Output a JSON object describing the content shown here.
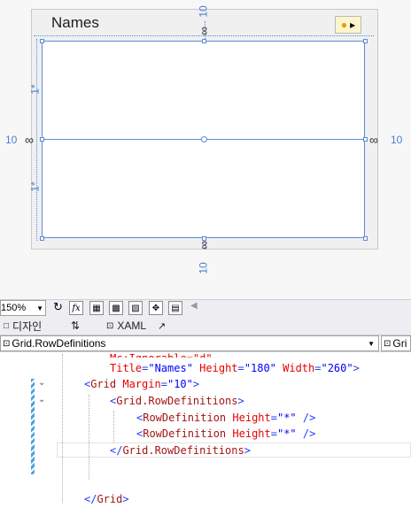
{
  "designer": {
    "window_title": "Names",
    "margin_top": "10",
    "margin_bottom": "10",
    "margin_left": "10",
    "margin_right": "10",
    "row_size_top": "1*",
    "row_size_bottom": "1*",
    "lightbulb_arrow": "▸"
  },
  "toolbar": {
    "zoom": "150%",
    "fx_label": "fx"
  },
  "tabs": {
    "design": "디자인",
    "swap": "⇅",
    "xaml": "XAML"
  },
  "path_bar": {
    "left": "Grid.RowDefinitions",
    "right": "Gri"
  },
  "code": {
    "line0": "Mc:Ignorable=\"d\"",
    "line1_attr1": "Title",
    "line1_val1": "\"Names\"",
    "line1_attr2": "Height",
    "line1_val2": "\"180\"",
    "line1_attr3": "Width",
    "line1_val3": "\"260\"",
    "line2_tag": "Grid",
    "line2_attr": "Margin",
    "line2_val": "\"10\"",
    "line3_tag": "Grid.RowDefinitions",
    "line4_tag": "RowDefinition",
    "line4_attr": "Height",
    "line4_val": "\"*\"",
    "line5_tag": "RowDefinition",
    "line5_attr": "Height",
    "line5_val": "\"*\"",
    "line6_tag": "Grid.RowDefinitions",
    "line8_tag": "Grid"
  }
}
